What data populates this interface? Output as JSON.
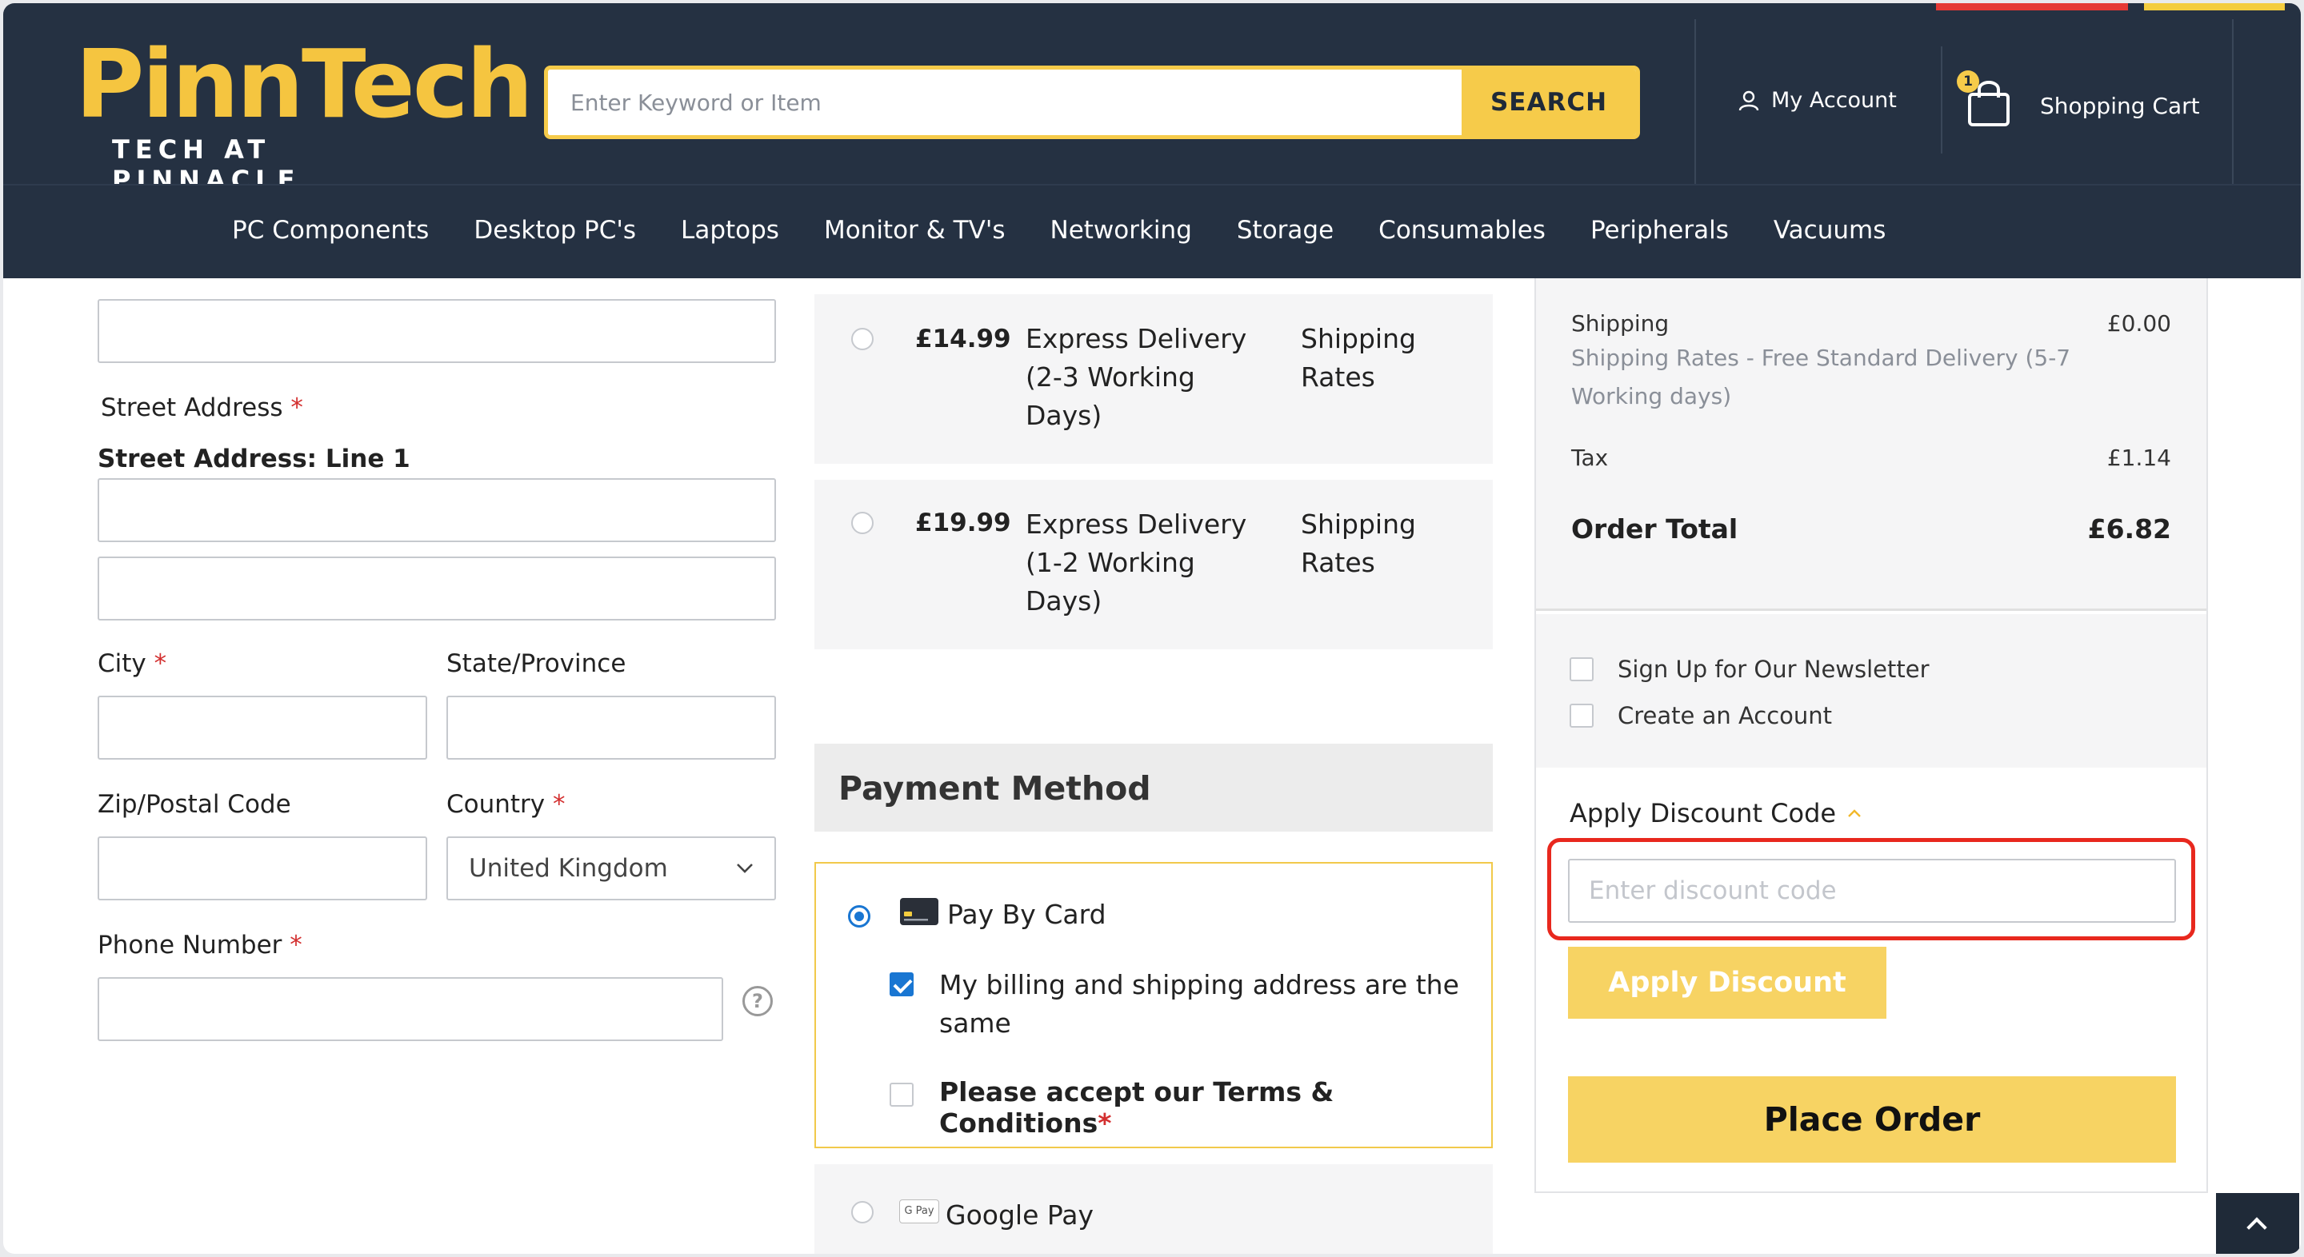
{
  "header": {
    "logo_text": "PinnTech",
    "logo_tagline": "TECH AT PINNACLE",
    "search_placeholder": "Enter Keyword or Item",
    "search_button": "SEARCH",
    "account_label": "My Account",
    "cart_label": "Shopping Cart",
    "cart_count": "1"
  },
  "nav": [
    "PC Components",
    "Desktop PC's",
    "Laptops",
    "Monitor & TV's",
    "Networking",
    "Storage",
    "Consumables",
    "Peripherals",
    "Vacuums"
  ],
  "form": {
    "street_label": "Street Address",
    "street_line1_label": "Street Address: Line 1",
    "city_label": "City",
    "state_label": "State/Province",
    "zip_label": "Zip/Postal Code",
    "country_label": "Country",
    "country_value": "United Kingdom",
    "phone_label": "Phone Number",
    "required_mark": "*",
    "help_glyph": "?"
  },
  "shipping_options": [
    {
      "price": "£14.99",
      "method_line1": "Express Delivery",
      "method_line2": "(2-3 Working",
      "method_line3": "Days)",
      "carrier_line1": "Shipping",
      "carrier_line2": "Rates"
    },
    {
      "price": "£19.99",
      "method_line1": "Express Delivery",
      "method_line2": "(1-2 Working",
      "method_line3": "Days)",
      "carrier_line1": "Shipping",
      "carrier_line2": "Rates"
    }
  ],
  "payment": {
    "heading": "Payment Method",
    "card_label": "Pay By Card",
    "same_address_line1": "My billing and shipping address are the",
    "same_address_line2": "same",
    "terms_label": "Please accept our Terms & Conditions",
    "gpay_label": "Google Pay",
    "gpay_icon_text": "G Pay"
  },
  "summary": {
    "shipping_label": "Shipping",
    "shipping_value": "£0.00",
    "shipping_desc_line1": "Shipping Rates - Free Standard Delivery (5-7",
    "shipping_desc_line2": "Working days)",
    "tax_label": "Tax",
    "tax_value": "£1.14",
    "total_label": "Order Total",
    "total_value": "£6.82",
    "newsletter_label": "Sign Up for Our Newsletter",
    "create_account_label": "Create an Account",
    "discount_title": "Apply Discount Code",
    "discount_placeholder": "Enter discount code",
    "apply_button": "Apply Discount",
    "place_order_button": "Place Order"
  },
  "colors": {
    "header_bg": "#253142",
    "brand_yellow": "#f6cb4a",
    "highlight_red": "#e8281e",
    "radio_blue": "#1976d2"
  }
}
